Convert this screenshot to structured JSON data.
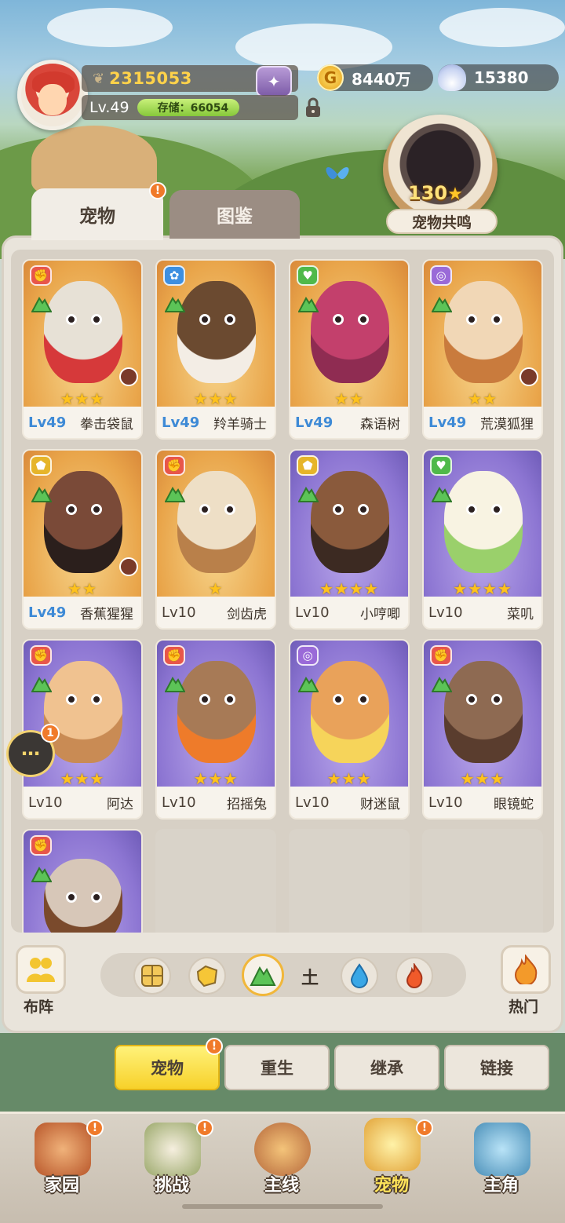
{
  "hud": {
    "power": "2315053",
    "level": "Lv.49",
    "storage": "存储：66054",
    "gold": "8440万",
    "shells": "15380",
    "resonance_count": "130",
    "resonance_label": "宠物共鸣"
  },
  "tabs": [
    {
      "label": "宠物",
      "badge": "!"
    },
    {
      "label": "图鉴"
    }
  ],
  "pets": [
    {
      "level": "Lv49",
      "name": "拳击袋鼠",
      "stars": "★★★",
      "theme": "gold",
      "element": "fire",
      "body_color": "#e7e1d6",
      "accent": "#d6393a"
    },
    {
      "level": "Lv49",
      "name": "羚羊骑士",
      "stars": "★★★",
      "theme": "gold",
      "element": "wind",
      "body_color": "#6b4a30",
      "accent": "#f3ede5"
    },
    {
      "level": "Lv49",
      "name": "森语树",
      "stars": "★★",
      "theme": "gold",
      "element": "heal",
      "body_color": "#c3406c",
      "accent": "#8f2c52"
    },
    {
      "level": "Lv49",
      "name": "荒漠狐狸",
      "stars": "★★",
      "theme": "gold",
      "element": "magic",
      "body_color": "#f1d7b6",
      "accent": "#c97b3d"
    },
    {
      "level": "Lv49",
      "name": "香蕉猩猩",
      "stars": "★★",
      "theme": "gold",
      "element": "shield",
      "body_color": "#7a4a38",
      "accent": "#2b1f1c"
    },
    {
      "level": "Lv10",
      "name": "剑齿虎",
      "stars": "★",
      "theme": "gold",
      "element": "fire",
      "body_color": "#eedfc6",
      "accent": "#b9804a"
    },
    {
      "level": "Lv10",
      "name": "小哼唧",
      "stars": "★★★★",
      "theme": "purple",
      "element": "shield",
      "body_color": "#8a5a3c",
      "accent": "#3c2a22"
    },
    {
      "level": "Lv10",
      "name": "菜叽",
      "stars": "★★★★",
      "theme": "purple",
      "element": "heal",
      "body_color": "#f8f3e2",
      "accent": "#9ad06b"
    },
    {
      "level": "Lv10",
      "name": "阿达",
      "stars": "★★★",
      "theme": "purple",
      "element": "fire",
      "body_color": "#f0c290",
      "accent": "#c98b54"
    },
    {
      "level": "Lv10",
      "name": "招摇兔",
      "stars": "★★★",
      "theme": "purple",
      "element": "fire",
      "body_color": "#a77a56",
      "accent": "#ee7b2a"
    },
    {
      "level": "Lv10",
      "name": "财迷鼠",
      "stars": "★★★",
      "theme": "purple",
      "element": "magic",
      "body_color": "#e9a25a",
      "accent": "#f6d45a"
    },
    {
      "level": "Lv10",
      "name": "眼镜蛇",
      "stars": "★★★",
      "theme": "purple",
      "element": "fire",
      "body_color": "#8e6a52",
      "accent": "#5a3d2e"
    },
    {
      "level": "",
      "name": "",
      "stars": "",
      "theme": "purple",
      "element": "fire",
      "body_color": "#d7c7b8",
      "accent": "#7a4a2c"
    }
  ],
  "filters": {
    "element_label": "土",
    "selected": "earth"
  },
  "side_buttons": {
    "formation": "布阵",
    "hot": "热门"
  },
  "chat": {
    "badge": "1"
  },
  "actions": [
    {
      "label": "宠物",
      "active": true,
      "badge": "!"
    },
    {
      "label": "重生",
      "active": false
    },
    {
      "label": "继承",
      "active": false
    },
    {
      "label": "链接",
      "active": false
    }
  ],
  "nav": [
    {
      "label": "家园",
      "badge": "!",
      "icon": "home-icon"
    },
    {
      "label": "挑战",
      "badge": "!",
      "icon": "challenge-icon"
    },
    {
      "label": "主线",
      "icon": "mainline-icon"
    },
    {
      "label": "宠物",
      "badge": "!",
      "active": true,
      "icon": "pet-icon"
    },
    {
      "label": "主角",
      "icon": "hero-icon"
    }
  ],
  "colors": {
    "level_high": "#3e8ad6",
    "badge_orange": "#f07a2a",
    "star_gold": "#ffc21c",
    "active_tab_yellow": "#f7d12a"
  }
}
